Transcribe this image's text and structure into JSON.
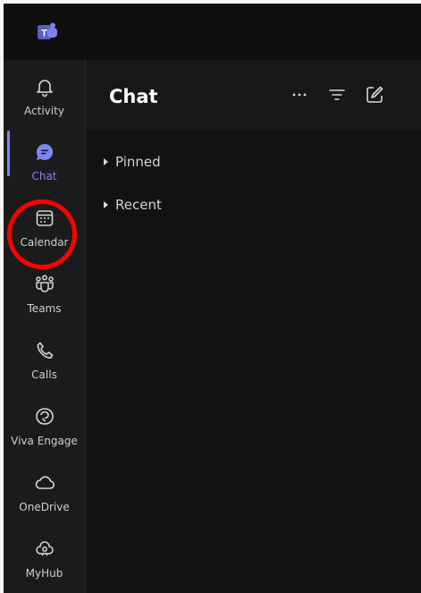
{
  "app": {
    "logo_icon": "teams-logo-icon",
    "accent_color": "#7f85f5",
    "annotation_color": "#ff0000"
  },
  "sidebar": {
    "items": [
      {
        "label": "Activity",
        "icon": "bell-icon"
      },
      {
        "label": "Chat",
        "icon": "chat-icon",
        "active": true
      },
      {
        "label": "Calendar",
        "icon": "calendar-icon"
      },
      {
        "label": "Teams",
        "icon": "teams-icon"
      },
      {
        "label": "Calls",
        "icon": "phone-icon"
      },
      {
        "label": "Viva Engage",
        "icon": "viva-engage-icon"
      },
      {
        "label": "OneDrive",
        "icon": "cloud-icon"
      },
      {
        "label": "MyHub",
        "icon": "myhub-icon"
      }
    ]
  },
  "main": {
    "title": "Chat",
    "header_actions": [
      {
        "icon": "more-options-icon"
      },
      {
        "icon": "filter-icon"
      },
      {
        "icon": "new-chat-icon"
      }
    ],
    "sections": [
      {
        "label": "Pinned",
        "icon": "caret-right-icon"
      },
      {
        "label": "Recent",
        "icon": "caret-right-icon"
      }
    ]
  }
}
